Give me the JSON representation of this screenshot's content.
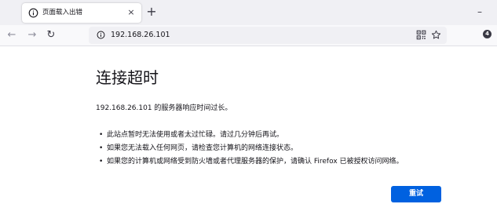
{
  "tab": {
    "title": "页面载入出错",
    "close_label": "×",
    "new_tab_label": "+"
  },
  "window": {
    "minimize_label": "–"
  },
  "nav": {
    "back_label": "←",
    "forward_label": "→",
    "reload_label": "↻",
    "url": "192.168.26.101",
    "extension_badge": "4"
  },
  "error": {
    "title": "连接超时",
    "description": "192.168.26.101 的服务器响应时间过长。",
    "suggestions": [
      "此站点暂时无法使用或者太过忙碌。请过几分钟后再试。",
      "如果您无法载入任何网页，请检查您计算机的网络连接状态。",
      "如果您的计算机或网络受到防火墙或者代理服务器的保护，请确认 Firefox 已被授权访问网络。"
    ],
    "retry_label": "重试"
  },
  "colors": {
    "accent": "#0061e0",
    "tabbar": "#f0f0f4",
    "toolbar": "#f9f9fb"
  }
}
